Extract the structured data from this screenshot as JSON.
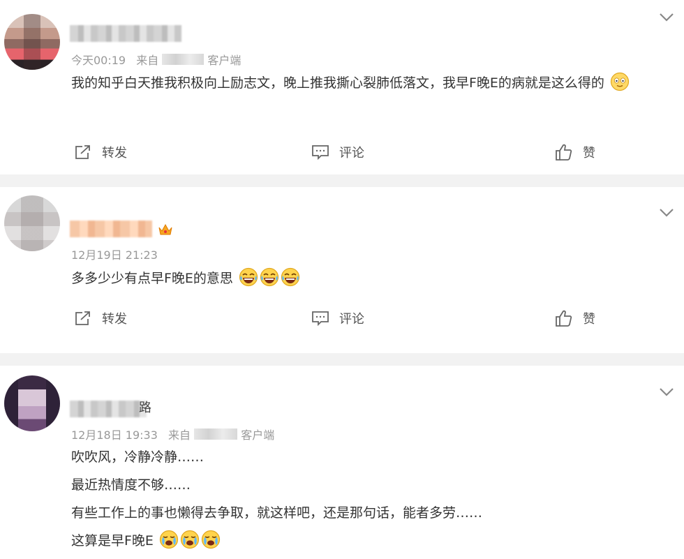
{
  "icons": {
    "collapse": "chevron-down-icon",
    "repost": "share-icon",
    "comment": "comment-icon",
    "like": "thumbs-up-icon",
    "crown": "crown-icon"
  },
  "colors": {
    "separator": "#f2f2f2",
    "meta": "#999999",
    "text": "#333333"
  },
  "posts": [
    {
      "time": "今天00:19",
      "from": "来自",
      "client": "客户端",
      "content": "我的知乎白天推我积极向上励志文，晚上推我撕心裂肺低落文，我早F晚E的病就是这么得的",
      "actions": {
        "repost": "转发",
        "comment": "评论",
        "like": "赞"
      }
    },
    {
      "time": "12月19日 21:23",
      "content": "多多少少有点早F晚E的意思",
      "actions": {
        "repost": "转发",
        "comment": "评论",
        "like": "赞"
      }
    },
    {
      "name_tail": "路",
      "time": "12月18日 19:33",
      "from": "来自",
      "client": "客户端",
      "lines": [
        "吹吹风，冷静冷静……",
        "最近热情度不够……",
        "有些工作上的事也懒得去争取，就这样吧，还是那句话，能者多劳……",
        "这算是早F晚E"
      ]
    }
  ]
}
